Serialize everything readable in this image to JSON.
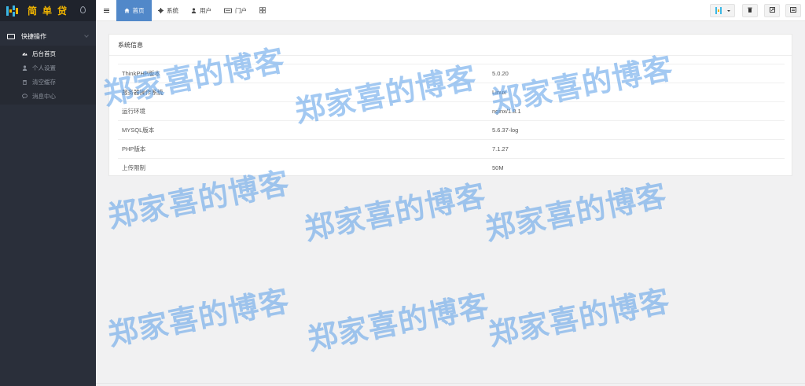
{
  "app": {
    "logo_text": "简单贷",
    "logo_icon": "logo-h-icon"
  },
  "sidebar": {
    "group_label": "快捷操作",
    "items": [
      {
        "label": "后台首页",
        "icon": "dashboard-icon",
        "active": true
      },
      {
        "label": "个人设置",
        "icon": "user-icon",
        "active": false
      },
      {
        "label": "清空缓存",
        "icon": "trash-icon",
        "active": false
      },
      {
        "label": "消息中心",
        "icon": "message-icon",
        "active": false
      }
    ]
  },
  "topnav": {
    "items": [
      {
        "label": "首页",
        "icon": "home-icon",
        "active": true
      },
      {
        "label": "系统",
        "icon": "gear-icon",
        "active": false
      },
      {
        "label": "用户",
        "icon": "user-icon",
        "active": false
      },
      {
        "label": "门户",
        "icon": "portal-icon",
        "active": false
      },
      {
        "label": "",
        "icon": "grid-icon",
        "active": false
      }
    ]
  },
  "toolbar": {
    "buttons": [
      "theme-logo-dropdown-button",
      "clear-cache-button",
      "fullscreen-button",
      "news-button"
    ]
  },
  "panel": {
    "title": "系统信息",
    "rows": [
      {
        "key": "ThinkPHP版本",
        "value": "5.0.20"
      },
      {
        "key": "服务器操作系统",
        "value": "Linux"
      },
      {
        "key": "运行环境",
        "value": "nginx/1.8.1"
      },
      {
        "key": "MYSQL版本",
        "value": "5.6.37-log"
      },
      {
        "key": "PHP版本",
        "value": "7.1.27"
      },
      {
        "key": "上传限制",
        "value": "50M"
      }
    ]
  },
  "watermark": {
    "text": "郑家喜的博客"
  },
  "colors": {
    "accent": "#5188c9",
    "sidebar_bg": "#2a2f3a",
    "logo_gold": "#f0b400",
    "watermark": "#589de8"
  }
}
